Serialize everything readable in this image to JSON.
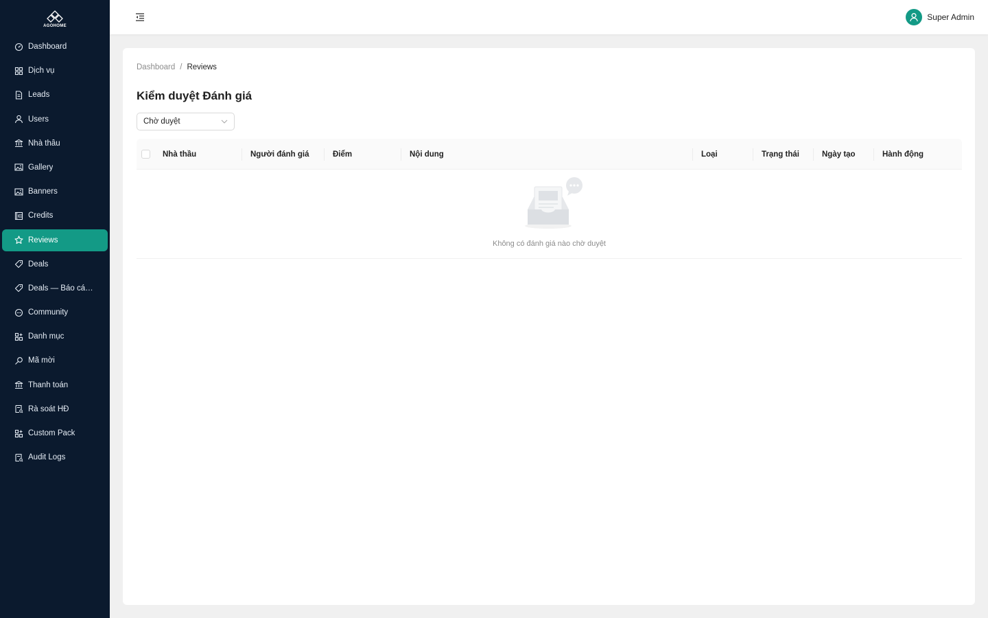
{
  "brand": {
    "name": "AGOHOME"
  },
  "sidebar": {
    "items": [
      {
        "label": "Dashboard",
        "icon": "dashboard-icon"
      },
      {
        "label": "Dịch vụ",
        "icon": "grid-icon"
      },
      {
        "label": "Leads",
        "icon": "file-icon"
      },
      {
        "label": "Users",
        "icon": "user-icon"
      },
      {
        "label": "Nhà thầu",
        "icon": "bank-icon"
      },
      {
        "label": "Gallery",
        "icon": "image-icon"
      },
      {
        "label": "Banners",
        "icon": "image-icon"
      },
      {
        "label": "Credits",
        "icon": "wallet-icon"
      },
      {
        "label": "Reviews",
        "icon": "star-icon",
        "active": true
      },
      {
        "label": "Deals",
        "icon": "tag-icon"
      },
      {
        "label": "Deals — Báo cáo ...",
        "icon": "tag-icon"
      },
      {
        "label": "Community",
        "icon": "message-icon"
      },
      {
        "label": "Danh mục",
        "icon": "appstore-icon"
      },
      {
        "label": "Mã mời",
        "icon": "key-icon"
      },
      {
        "label": "Thanh toán",
        "icon": "bank-icon"
      },
      {
        "label": "Rà soát HĐ",
        "icon": "audit-icon"
      },
      {
        "label": "Custom Pack",
        "icon": "appstore-icon"
      },
      {
        "label": "Audit Logs",
        "icon": "audit-icon"
      }
    ]
  },
  "header": {
    "user_name": "Super Admin"
  },
  "breadcrumb": {
    "root": "Dashboard",
    "separator": "/",
    "current": "Reviews"
  },
  "page": {
    "title": "Kiểm duyệt Đánh giá"
  },
  "filter": {
    "selected": "Chờ duyệt"
  },
  "table": {
    "columns": [
      "Nhà thầu",
      "Người đánh giá",
      "Điểm",
      "Nội dung",
      "Loại",
      "Trạng thái",
      "Ngày tạo",
      "Hành động"
    ],
    "rows": [],
    "empty_text": "Không có đánh giá nào chờ duyệt"
  },
  "colors": {
    "sidebar_bg": "#0b1a2e",
    "accent": "#139a86",
    "page_bg": "#f0f0f0"
  }
}
